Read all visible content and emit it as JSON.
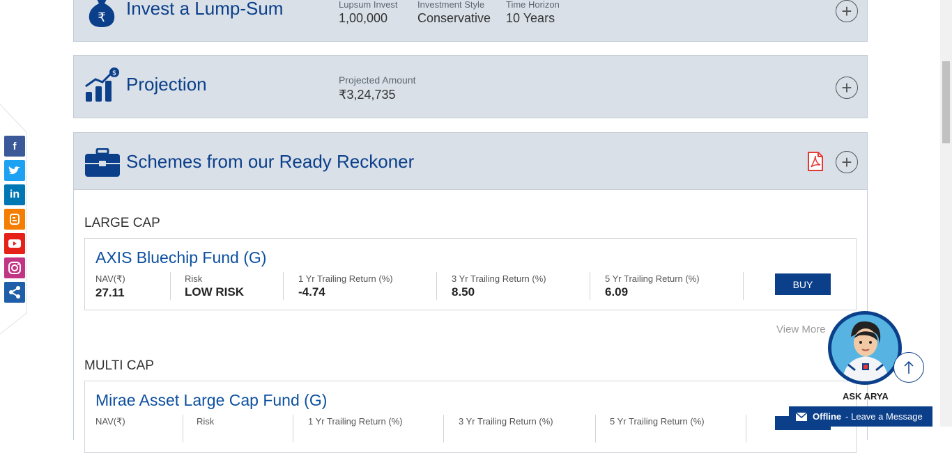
{
  "lumpsum": {
    "title": "Invest a Lump-Sum",
    "icon": "rupee-bag-icon",
    "fields": [
      {
        "label": "Lupsum Invest",
        "value": "1,00,000"
      },
      {
        "label": "Investment Style",
        "value": "Conservative"
      },
      {
        "label": "Time Horizon",
        "value": "10 Years"
      }
    ]
  },
  "projection": {
    "title": "Projection",
    "icon": "growth-chart-icon",
    "amount_label": "Projected Amount",
    "amount_value": "₹3,24,735"
  },
  "schemes": {
    "title": "Schemes from our Ready Reckoner",
    "icon": "briefcase-icon",
    "pdf_icon": "pdf-icon"
  },
  "categories": [
    {
      "name": "LARGE CAP",
      "fund": "AXIS Bluechip Fund (G)",
      "nav_label": "NAV(₹)",
      "nav": "27.11",
      "risk_label": "Risk",
      "risk": "LOW RISK",
      "r1_label": "1 Yr Trailing Return (%)",
      "r1": "-4.74",
      "r3_label": "3 Yr Trailing Return (%)",
      "r3": "8.50",
      "r5_label": "5 Yr Trailing Return (%)",
      "r5": "6.09",
      "buy": "BUY"
    },
    {
      "name": "MULTI CAP",
      "fund": "Mirae Asset Large Cap Fund (G)",
      "nav_label": "NAV(₹)",
      "risk_label": "Risk",
      "r1_label": "1 Yr Trailing Return (%)",
      "r3_label": "3 Yr Trailing Return (%)",
      "r5_label": "5 Yr Trailing Return (%)"
    }
  ],
  "view_more": "View More",
  "chat": {
    "label": "ASK ARYA",
    "offline_status": "Offline",
    "offline_text": "- Leave a Message"
  },
  "social": [
    "facebook-icon",
    "twitter-icon",
    "linkedin-icon",
    "blogger-icon",
    "youtube-icon",
    "instagram-icon",
    "share-icon"
  ],
  "colors": {
    "brand": "#0b3f8a",
    "panel": "#d9e0e8",
    "pdf": "#e53935"
  }
}
